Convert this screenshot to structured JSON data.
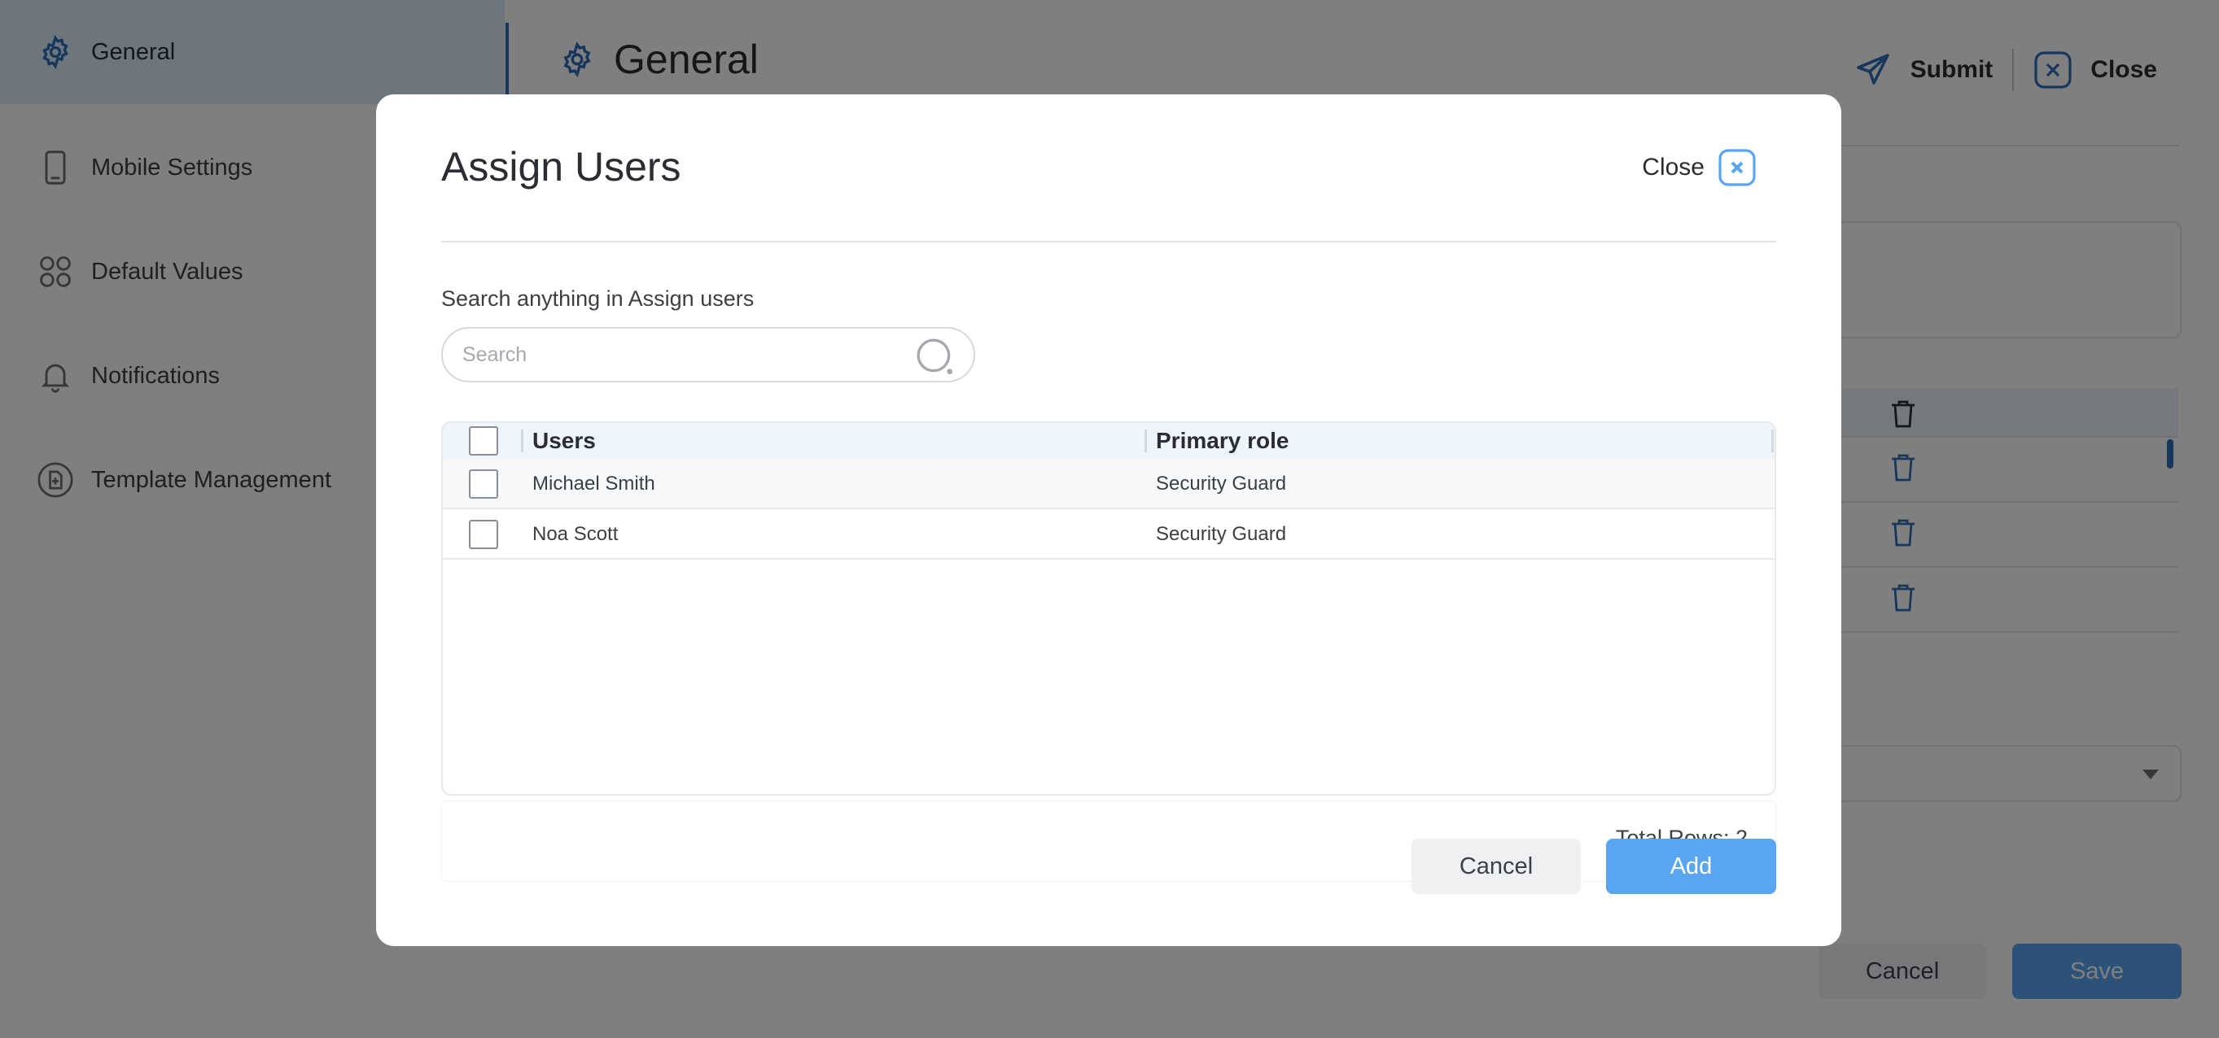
{
  "sidebar": {
    "items": [
      {
        "label": "General",
        "icon": "gear-icon",
        "active": true
      },
      {
        "label": "Mobile Settings",
        "icon": "mobile-icon"
      },
      {
        "label": "Default Values",
        "icon": "grid-circles-icon"
      },
      {
        "label": "Notifications",
        "icon": "bell-icon"
      },
      {
        "label": "Template Management",
        "icon": "template-icon"
      }
    ]
  },
  "header": {
    "title": "General",
    "title_icon": "gear-icon",
    "submit_label": "Submit",
    "close_label": "Close"
  },
  "footer": {
    "cancel_label": "Cancel",
    "save_label": "Save"
  },
  "modal": {
    "title": "Assign Users",
    "close_label": "Close",
    "search_label": "Search anything in Assign users",
    "search_placeholder": "Search",
    "search_value": "",
    "columns": [
      "Users",
      "Primary role"
    ],
    "rows": [
      {
        "user": "Michael Smith",
        "role": "Security Guard",
        "checked": false
      },
      {
        "user": "Noa Scott",
        "role": "Security Guard",
        "checked": false
      }
    ],
    "total_rows_label": "Total Rows: 2",
    "cancel_label": "Cancel",
    "add_label": "Add"
  },
  "colors": {
    "accent": "#2f6db8",
    "primary_button": "#5aa5f0",
    "active_sidebar_bg": "#d9edf9",
    "overlay": "rgba(0,0,0,0.5)"
  }
}
